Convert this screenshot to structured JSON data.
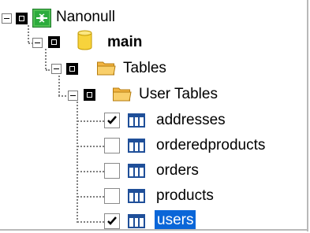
{
  "tree": {
    "root": {
      "label": "Nanonull",
      "icon": "database-connection-icon",
      "checked": true
    },
    "schema": {
      "label": "main",
      "icon": "database-cylinder-icon",
      "checked": true
    },
    "tables_folder": {
      "label": "Tables",
      "icon": "folder-icon",
      "checked": true
    },
    "user_tables_folder": {
      "label": "User Tables",
      "icon": "folder-icon",
      "checked": true
    },
    "tables": [
      {
        "label": "addresses",
        "checked": true,
        "selected": false
      },
      {
        "label": "orderedproducts",
        "checked": false,
        "selected": false
      },
      {
        "label": "orders",
        "checked": false,
        "selected": false
      },
      {
        "label": "products",
        "checked": false,
        "selected": false
      },
      {
        "label": "users",
        "checked": true,
        "selected": true
      }
    ]
  },
  "colors": {
    "selection": "#0a66d8",
    "folder": "#f2b441",
    "cylinder": "#f7d33c",
    "table_icon": "#1f4f99",
    "connection_green": "#2cab3c"
  }
}
